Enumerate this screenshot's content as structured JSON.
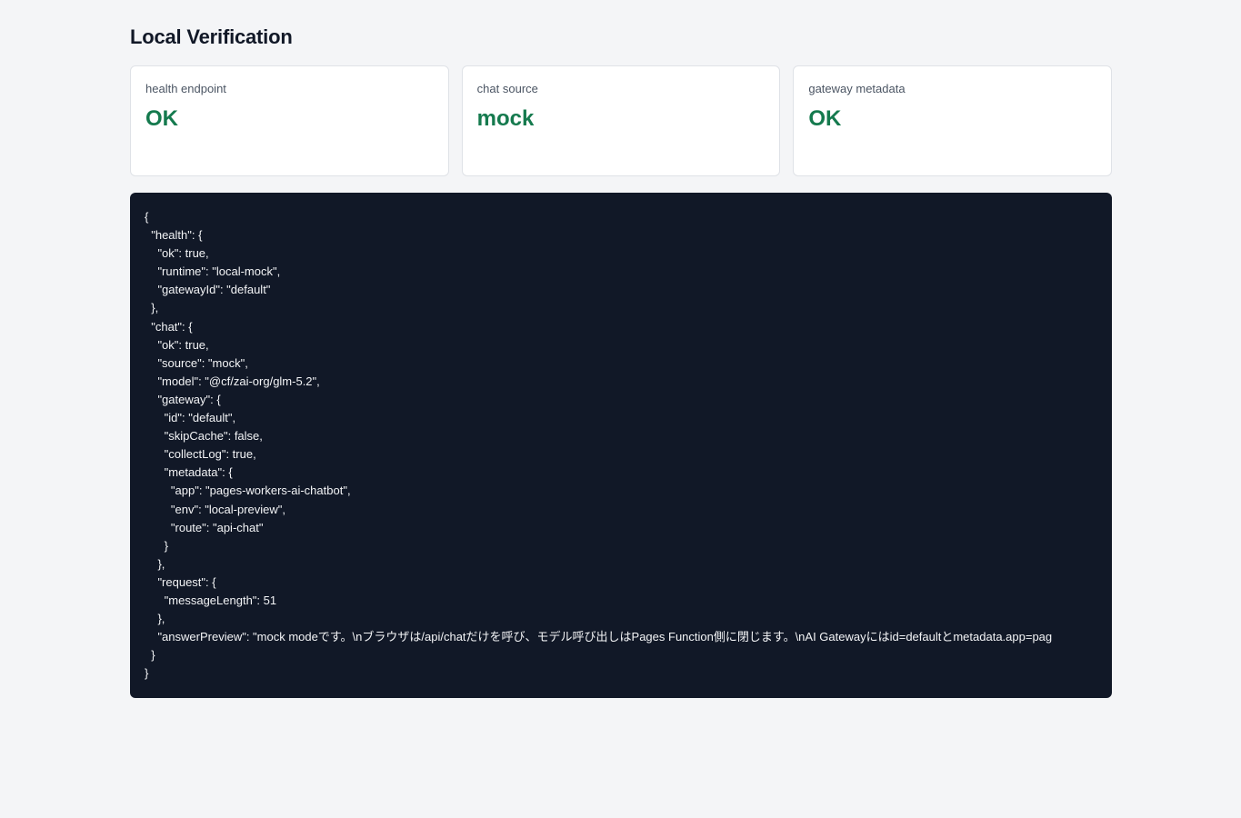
{
  "page": {
    "title": "Local Verification"
  },
  "colors": {
    "background": "#f4f5f7",
    "card_background": "#ffffff",
    "status_ok": "#157a4e",
    "code_background": "#111827",
    "code_text": "#f3f4f6"
  },
  "cards": [
    {
      "label": "health endpoint",
      "value": "OK"
    },
    {
      "label": "chat source",
      "value": "mock"
    },
    {
      "label": "gateway metadata",
      "value": "OK"
    }
  ],
  "json_output": "{\n  \"health\": {\n    \"ok\": true,\n    \"runtime\": \"local-mock\",\n    \"gatewayId\": \"default\"\n  },\n  \"chat\": {\n    \"ok\": true,\n    \"source\": \"mock\",\n    \"model\": \"@cf/zai-org/glm-5.2\",\n    \"gateway\": {\n      \"id\": \"default\",\n      \"skipCache\": false,\n      \"collectLog\": true,\n      \"metadata\": {\n        \"app\": \"pages-workers-ai-chatbot\",\n        \"env\": \"local-preview\",\n        \"route\": \"api-chat\"\n      }\n    },\n    \"request\": {\n      \"messageLength\": 51\n    },\n    \"answerPreview\": \"mock modeです。\\nブラウザは/api/chatだけを呼び、モデル呼び出しはPages Function側に閉じます。\\nAI Gatewayにはid=defaultとmetadata.app=pag\n  }\n}"
}
